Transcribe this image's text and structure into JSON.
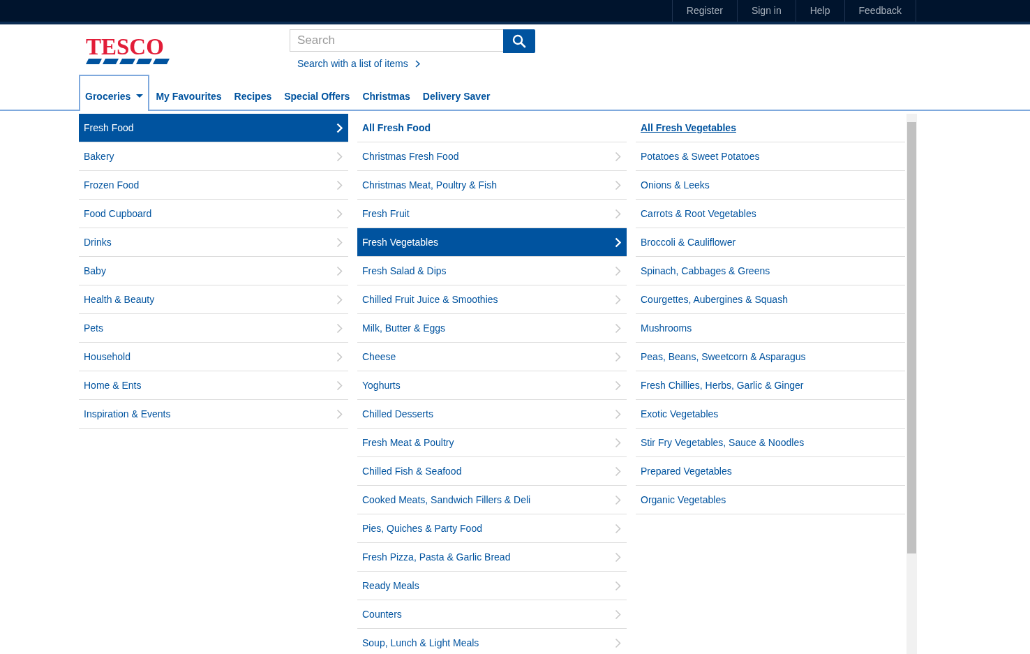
{
  "top_links": [
    "Register",
    "Sign in",
    "Help",
    "Feedback"
  ],
  "logo": {
    "text": "TESCO"
  },
  "search": {
    "placeholder": "Search",
    "list_link": "Search with a list of items"
  },
  "nav": [
    {
      "label": "Groceries",
      "selected": true,
      "dropdown": true
    },
    {
      "label": "My Favourites",
      "selected": false,
      "dropdown": false
    },
    {
      "label": "Recipes",
      "selected": false,
      "dropdown": false
    },
    {
      "label": "Special Offers",
      "selected": false,
      "dropdown": false
    },
    {
      "label": "Christmas",
      "selected": false,
      "dropdown": false
    },
    {
      "label": "Delivery Saver",
      "selected": false,
      "dropdown": false
    }
  ],
  "menu_columns": [
    [
      {
        "label": "Fresh Food",
        "kind": "category",
        "selected": true
      },
      {
        "label": "Bakery",
        "kind": "category",
        "selected": false
      },
      {
        "label": "Frozen Food",
        "kind": "category",
        "selected": false
      },
      {
        "label": "Food Cupboard",
        "kind": "category",
        "selected": false
      },
      {
        "label": "Drinks",
        "kind": "category",
        "selected": false
      },
      {
        "label": "Baby",
        "kind": "category",
        "selected": false
      },
      {
        "label": "Health & Beauty",
        "kind": "category",
        "selected": false
      },
      {
        "label": "Pets",
        "kind": "category",
        "selected": false
      },
      {
        "label": "Household",
        "kind": "category",
        "selected": false
      },
      {
        "label": "Home & Ents",
        "kind": "category",
        "selected": false
      },
      {
        "label": "Inspiration & Events",
        "kind": "category",
        "selected": false
      }
    ],
    [
      {
        "label": "All Fresh Food",
        "kind": "all",
        "selected": false
      },
      {
        "label": "Christmas Fresh Food",
        "kind": "category",
        "selected": false
      },
      {
        "label": "Christmas Meat, Poultry & Fish",
        "kind": "category",
        "selected": false
      },
      {
        "label": "Fresh Fruit",
        "kind": "category",
        "selected": false
      },
      {
        "label": "Fresh Vegetables",
        "kind": "category",
        "selected": true
      },
      {
        "label": "Fresh Salad & Dips",
        "kind": "category",
        "selected": false
      },
      {
        "label": "Chilled Fruit Juice & Smoothies",
        "kind": "category",
        "selected": false
      },
      {
        "label": "Milk, Butter & Eggs",
        "kind": "category",
        "selected": false
      },
      {
        "label": "Cheese",
        "kind": "category",
        "selected": false
      },
      {
        "label": "Yoghurts",
        "kind": "category",
        "selected": false
      },
      {
        "label": "Chilled Desserts",
        "kind": "category",
        "selected": false
      },
      {
        "label": "Fresh Meat & Poultry",
        "kind": "category",
        "selected": false
      },
      {
        "label": "Chilled Fish & Seafood",
        "kind": "category",
        "selected": false
      },
      {
        "label": "Cooked Meats, Sandwich Fillers & Deli",
        "kind": "category",
        "selected": false
      },
      {
        "label": "Pies, Quiches & Party Food",
        "kind": "category",
        "selected": false
      },
      {
        "label": "Fresh Pizza, Pasta & Garlic Bread",
        "kind": "category",
        "selected": false
      },
      {
        "label": "Ready Meals",
        "kind": "category",
        "selected": false
      },
      {
        "label": "Counters",
        "kind": "category",
        "selected": false
      },
      {
        "label": "Soup, Lunch & Light Meals",
        "kind": "category",
        "selected": false
      }
    ],
    [
      {
        "label": "All Fresh Vegetables",
        "kind": "all_underlined",
        "selected": false
      },
      {
        "label": "Potatoes & Sweet Potatoes",
        "kind": "leaf",
        "selected": false
      },
      {
        "label": "Onions & Leeks",
        "kind": "leaf",
        "selected": false
      },
      {
        "label": "Carrots & Root Vegetables",
        "kind": "leaf",
        "selected": false
      },
      {
        "label": "Broccoli & Cauliflower",
        "kind": "leaf",
        "selected": false
      },
      {
        "label": "Spinach, Cabbages & Greens",
        "kind": "leaf",
        "selected": false
      },
      {
        "label": "Courgettes, Aubergines & Squash",
        "kind": "leaf",
        "selected": false
      },
      {
        "label": "Mushrooms",
        "kind": "leaf",
        "selected": false
      },
      {
        "label": "Peas, Beans, Sweetcorn & Asparagus",
        "kind": "leaf",
        "selected": false
      },
      {
        "label": "Fresh Chillies, Herbs, Garlic & Ginger",
        "kind": "leaf",
        "selected": false
      },
      {
        "label": "Exotic Vegetables",
        "kind": "leaf",
        "selected": false
      },
      {
        "label": "Stir Fry Vegetables, Sauce & Noodles",
        "kind": "leaf",
        "selected": false
      },
      {
        "label": "Prepared Vegetables",
        "kind": "leaf",
        "selected": false
      },
      {
        "label": "Organic Vegetables",
        "kind": "leaf",
        "selected": false
      }
    ]
  ]
}
